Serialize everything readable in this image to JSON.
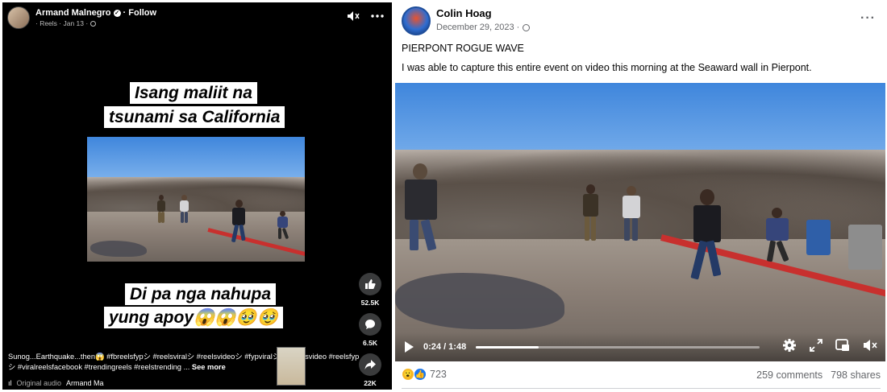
{
  "reel": {
    "author": "Armand Malnegro",
    "follow": "Follow",
    "meta": "· Reels · Jan 13 ·",
    "caption_line1": "Isang maliit na",
    "caption_line2": "tsunami sa California",
    "caption_line3": "Di pa nga nahupa",
    "caption_line4": "yung apoy😱😱🥹🥹",
    "likes": "52.5K",
    "comments": "6.5K",
    "shares": "22K",
    "description": "Sunog...Earthquake...then😱 #fbreelsfypシ #reelsviralシ #reelsvideoシ #fypviralシ #fbreelsvideo #reelsfypシ #viralreelsfacebook #trendingreels #reelstrending ...",
    "see_more": "See more",
    "audio_label": "Original audio",
    "audio_author": "Armand Ma"
  },
  "post": {
    "author": "Colin Hoag",
    "date": "December 29, 2023 ·",
    "title": "PIERPONT ROGUE WAVE",
    "body": "I was able to capture this entire event on video this morning at the Seaward wall in Pierpont.",
    "video_time": "0:24 / 1:48",
    "progress": 0.2222,
    "reaction_count": "723",
    "comments": "259 comments",
    "shares": "798 shares"
  },
  "icons": {
    "mute": "mute-icon",
    "more": "more-options-icon",
    "like": "like-icon",
    "comment": "comment-icon",
    "share": "share-icon",
    "settings": "settings-icon",
    "fullscreen": "fullscreen-icon",
    "pip": "picture-in-picture-icon",
    "volume": "volume-muted-icon"
  },
  "colors": {
    "facebook_blue": "#1877f2",
    "reel_bg": "#000000",
    "curb_red": "#c8302e"
  }
}
